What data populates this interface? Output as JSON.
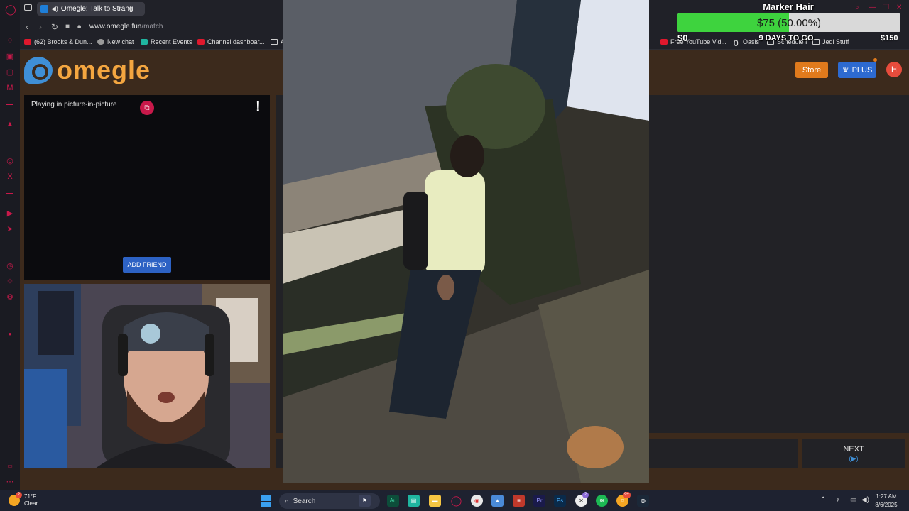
{
  "browser": {
    "tab": {
      "title": "Omegle: Talk to Strang"
    },
    "url_domain": "www.omegle.fun",
    "url_path": "/match",
    "bookmarks": [
      "(62) Brooks & Dun...",
      "New chat",
      "Recent Events",
      "Channel dashboar...",
      "A",
      "Free YouTube Vid...",
      "0",
      "Oasis",
      "Schedule I",
      "Jedi Stuff"
    ]
  },
  "page": {
    "logo_text": "omegle",
    "store_label": "Store",
    "plus_label": "PLUS",
    "avatar_initial": "H",
    "stranger": {
      "pip_label": "Playing in picture-in-picture",
      "report_label": "!",
      "add_friend_label": "ADD FRIEND"
    },
    "next": {
      "label": "NEXT",
      "key_hint": "(▶)"
    }
  },
  "stream_overlay": {
    "goal": {
      "title": "Marker Hair",
      "progress_text": "$75 (50.00%)",
      "progress_fraction": 0.5,
      "min_label": "$0",
      "max_label": "$150",
      "days_label": "9 DAYS TO GO",
      "fill_color": "#3ed33e"
    }
  },
  "taskbar": {
    "weather_temp": "71°F",
    "weather_desc": "Clear",
    "weather_badge": "2",
    "search_label": "Search",
    "xbox_badge": "2",
    "discord_badge": "9+",
    "time": "1:27 AM",
    "date": "8/6/2025"
  },
  "colors": {
    "accent_opera": "#c8194a",
    "omegle_orange": "#f4a640",
    "omegle_blue": "#3f8fd6",
    "page_bg": "#3c2a1c"
  }
}
